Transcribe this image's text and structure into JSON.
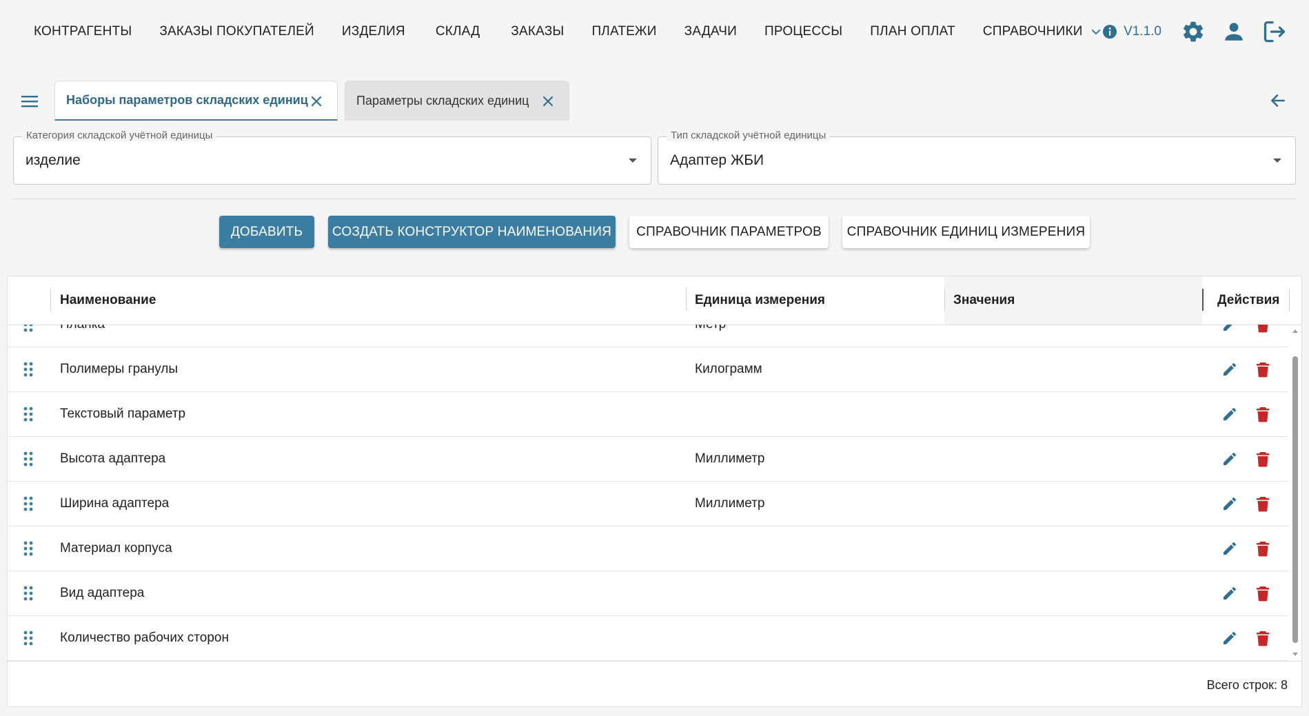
{
  "nav": {
    "items": [
      {
        "label": "КОНТРАГЕНТЫ"
      },
      {
        "label": "ЗАКАЗЫ ПОКУПАТЕЛЕЙ"
      },
      {
        "label": "ИЗДЕЛИЯ"
      },
      {
        "label": "СКЛАД"
      },
      {
        "label": "ЗАКАЗЫ"
      },
      {
        "label": "ПЛАТЕЖИ"
      },
      {
        "label": "ЗАДАЧИ"
      },
      {
        "label": "ПРОЦЕССЫ"
      },
      {
        "label": "ПЛАН ОПЛАТ"
      },
      {
        "label": "СПРАВОЧНИКИ"
      }
    ],
    "version": "V1.1.0",
    "icons": {
      "info": "info-icon",
      "settings": "gear-icon",
      "user": "user-icon",
      "logout": "logout-icon",
      "dropdown": "chevron-down-icon"
    }
  },
  "tabs": [
    {
      "label": "Наборы параметров складских единиц",
      "active": true
    },
    {
      "label": "Параметры складских единиц",
      "active": false
    }
  ],
  "filters": {
    "category": {
      "label": "Категория складской учётной единицы",
      "value": "изделие"
    },
    "type": {
      "label": "Тип складской учётной единицы",
      "value": "Адаптер ЖБИ"
    }
  },
  "actions": {
    "add": "ДОБАВИТЬ",
    "create_constructor": "СОЗДАТЬ КОНСТРУКТОР НАИМЕНОВАНИЯ",
    "params_reference": "СПРАВОЧНИК ПАРАМЕТРОВ",
    "units_reference": "СПРАВОЧНИК ЕДИНИЦ ИЗМЕРЕНИЯ"
  },
  "table": {
    "columns": {
      "name": "Наименование",
      "unit": "Единица измерения",
      "values": "Значения",
      "actions": "Действия"
    },
    "rows": [
      {
        "name": "Планка",
        "unit": "Метр",
        "values": ""
      },
      {
        "name": "Полимеры гранулы",
        "unit": "Килограмм",
        "values": ""
      },
      {
        "name": "Текстовый параметр",
        "unit": "",
        "values": ""
      },
      {
        "name": "Высота адаптера",
        "unit": "Миллиметр",
        "values": ""
      },
      {
        "name": "Ширина адаптера",
        "unit": "Миллиметр",
        "values": ""
      },
      {
        "name": "Материал корпуса",
        "unit": "",
        "values": ""
      },
      {
        "name": "Вид адаптера",
        "unit": "",
        "values": ""
      },
      {
        "name": "Количество рабочих сторон",
        "unit": "",
        "values": ""
      }
    ],
    "footer": "Всего строк: 8"
  },
  "colors": {
    "accent": "#3b7ea2",
    "delete": "#c62828",
    "edit": "#2f6f8f"
  }
}
